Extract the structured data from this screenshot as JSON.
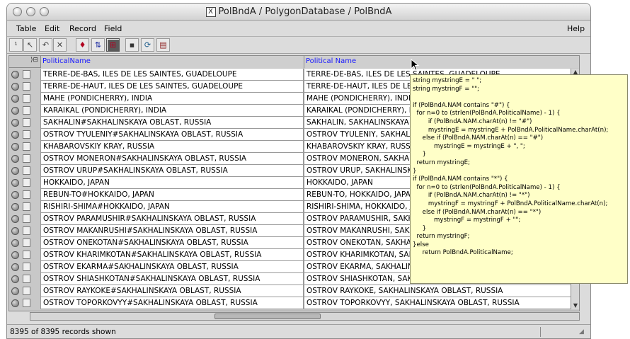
{
  "window": {
    "title": "PolBndA / PolygonDatabase / PolBndA",
    "x_icon": "X"
  },
  "menu": {
    "items": [
      "Table",
      "Edit",
      "Record",
      "Field"
    ],
    "help": "Help"
  },
  "toolbar": {
    "buttons": [
      {
        "icon": "record-number-icon",
        "glyph": "¹"
      },
      {
        "icon": "select-arrow-icon",
        "glyph": "↖"
      },
      {
        "icon": "undo-icon",
        "glyph": "↶"
      },
      {
        "icon": "tools-icon",
        "glyph": "✕"
      },
      {
        "icon": "query-icon",
        "glyph": "♦"
      },
      {
        "icon": "sort-icon",
        "glyph": "⇅"
      },
      {
        "icon": "filter-icon",
        "glyph": "⊞"
      },
      {
        "icon": "save-icon",
        "glyph": "▪"
      },
      {
        "icon": "refresh-icon",
        "glyph": "⟳"
      },
      {
        "icon": "report-icon",
        "glyph": "▤"
      }
    ]
  },
  "table": {
    "columns": [
      "PoliticalName",
      "Political Name"
    ],
    "rows": [
      [
        "TERRE-DE-BAS, ILES DE LES SAINTES, GUADELOUPE",
        "TERRE-DE-BAS, ILES DE LES SAINTES, GUADELOUPE"
      ],
      [
        "TERRE-DE-HAUT, ILES DE LES SAINTES, GUADELOUPE",
        "TERRE-DE-HAUT, ILES DE LES SAINTES, GUADELOUPE"
      ],
      [
        "MAHE (PONDICHERRY), INDIA",
        "MAHE (PONDICHERRY), INDIA"
      ],
      [
        "KARAIKAL (PONDICHERRY), INDIA",
        "KARAIKAL (PONDICHERRY), INDIA"
      ],
      [
        "SAKHALIN#SAKHALINSKAYA OBLAST, RUSSIA",
        "SAKHALIN, SAKHALINSKAYA OBLAST, RUSSIA"
      ],
      [
        "OSTROV TYULENIY#SAKHALINSKAYA OBLAST, RUSSIA",
        "OSTROV TYULENIY, SAKHALINSKAYA OBLAST, RUSSIA"
      ],
      [
        "KHABAROVSKIY KRAY, RUSSIA",
        "KHABAROVSKIY KRAY, RUSSIA"
      ],
      [
        "OSTROV MONERON#SAKHALINSKAYA OBLAST, RUSSIA",
        "OSTROV MONERON, SAKHALINSKAYA OBLAST, RUSSIA"
      ],
      [
        "OSTROV URUP#SAKHALINSKAYA OBLAST, RUSSIA",
        "OSTROV URUP, SAKHALINSKAYA OBLAST, RUSSIA"
      ],
      [
        "HOKKAIDO, JAPAN",
        "HOKKAIDO, JAPAN"
      ],
      [
        "REBUN-TO#HOKKAIDO, JAPAN",
        "REBUN-TO, HOKKAIDO, JAPAN"
      ],
      [
        "RISHIRI-SHIMA#HOKKAIDO, JAPAN",
        "RISHIRI-SHIMA, HOKKAIDO, JAPAN"
      ],
      [
        "OSTROV PARAMUSHIR#SAKHALINSKAYA OBLAST, RUSSIA",
        "OSTROV PARAMUSHIR, SAKHALINSKAYA OBLAST, RUSSIA"
      ],
      [
        "OSTROV MAKANRUSHI#SAKHALINSKAYA OBLAST, RUSSIA",
        "OSTROV MAKANRUSHI, SAKHALINSKAYA OBLAST, RUSSIA"
      ],
      [
        "OSTROV ONEKOTAN#SAKHALINSKAYA OBLAST, RUSSIA",
        "OSTROV ONEKOTAN, SAKHALINSKAYA OBLAST, RUSSIA"
      ],
      [
        "OSTROV KHARIMKOTAN#SAKHALINSKAYA OBLAST, RUSSIA",
        "OSTROV KHARIMKOTAN, SAKHALINSKAYA OBLAST, RUSSIA"
      ],
      [
        "OSTROV EKARMA#SAKHALINSKAYA OBLAST, RUSSIA",
        "OSTROV EKARMA, SAKHALINSKAYA OBLAST, RUSSIA"
      ],
      [
        "OSTROV SHIASHKOTAN#SAKHALINSKAYA OBLAST, RUSSIA",
        "OSTROV SHIASHKOTAN, SAKHALINSKAYA OBLAST, RUSSIA"
      ],
      [
        "OSTROV RAYKOKE#SAKHALINSKAYA OBLAST, RUSSIA",
        "OSTROV RAYKOKE, SAKHALINSKAYA OBLAST, RUSSIA"
      ],
      [
        "OSTROV TOPORKOVYY#SAKHALINSKAYA OBLAST, RUSSIA",
        "OSTROV TOPORKOVYY, SAKHALINSKAYA OBLAST, RUSSIA"
      ]
    ]
  },
  "tooltip": {
    "code": "string mystringE = \" \";\nstring mystringF = \"\";\n\nif (PolBndA.NAM contains \"#\") {\n  for n=0 to (strlen(PolBndA.PoliticalName) - 1) {\n        if (PolBndA.NAM.charAt(n) != \"#\")\n        mystringE = mystringE + PolBndA.PoliticalName.charAt(n);\n     else if (PolBndA.NAM.charAt(n) == \"#\")\n           mystringE = mystringE + \", \";\n     }\n  return mystringE;\n}\nif (PolBndA.NAM contains \"*\") {\n  for n=0 to (strlen(PolBndA.PoliticalName) - 1) {\n        if (PolBndA.NAM.charAt(n) != \"*\")\n        mystringF = mystringF + PolBndA.PoliticalName.charAt(n);\n     else if (PolBndA.NAM.charAt(n) == \"*\")\n           mystringF = mystringF + \"\";\n     }\n  return mystringF;\n}else\n     return PolBndA.PoliticalName;"
  },
  "status": {
    "records": "8395 of 8395 records shown"
  }
}
